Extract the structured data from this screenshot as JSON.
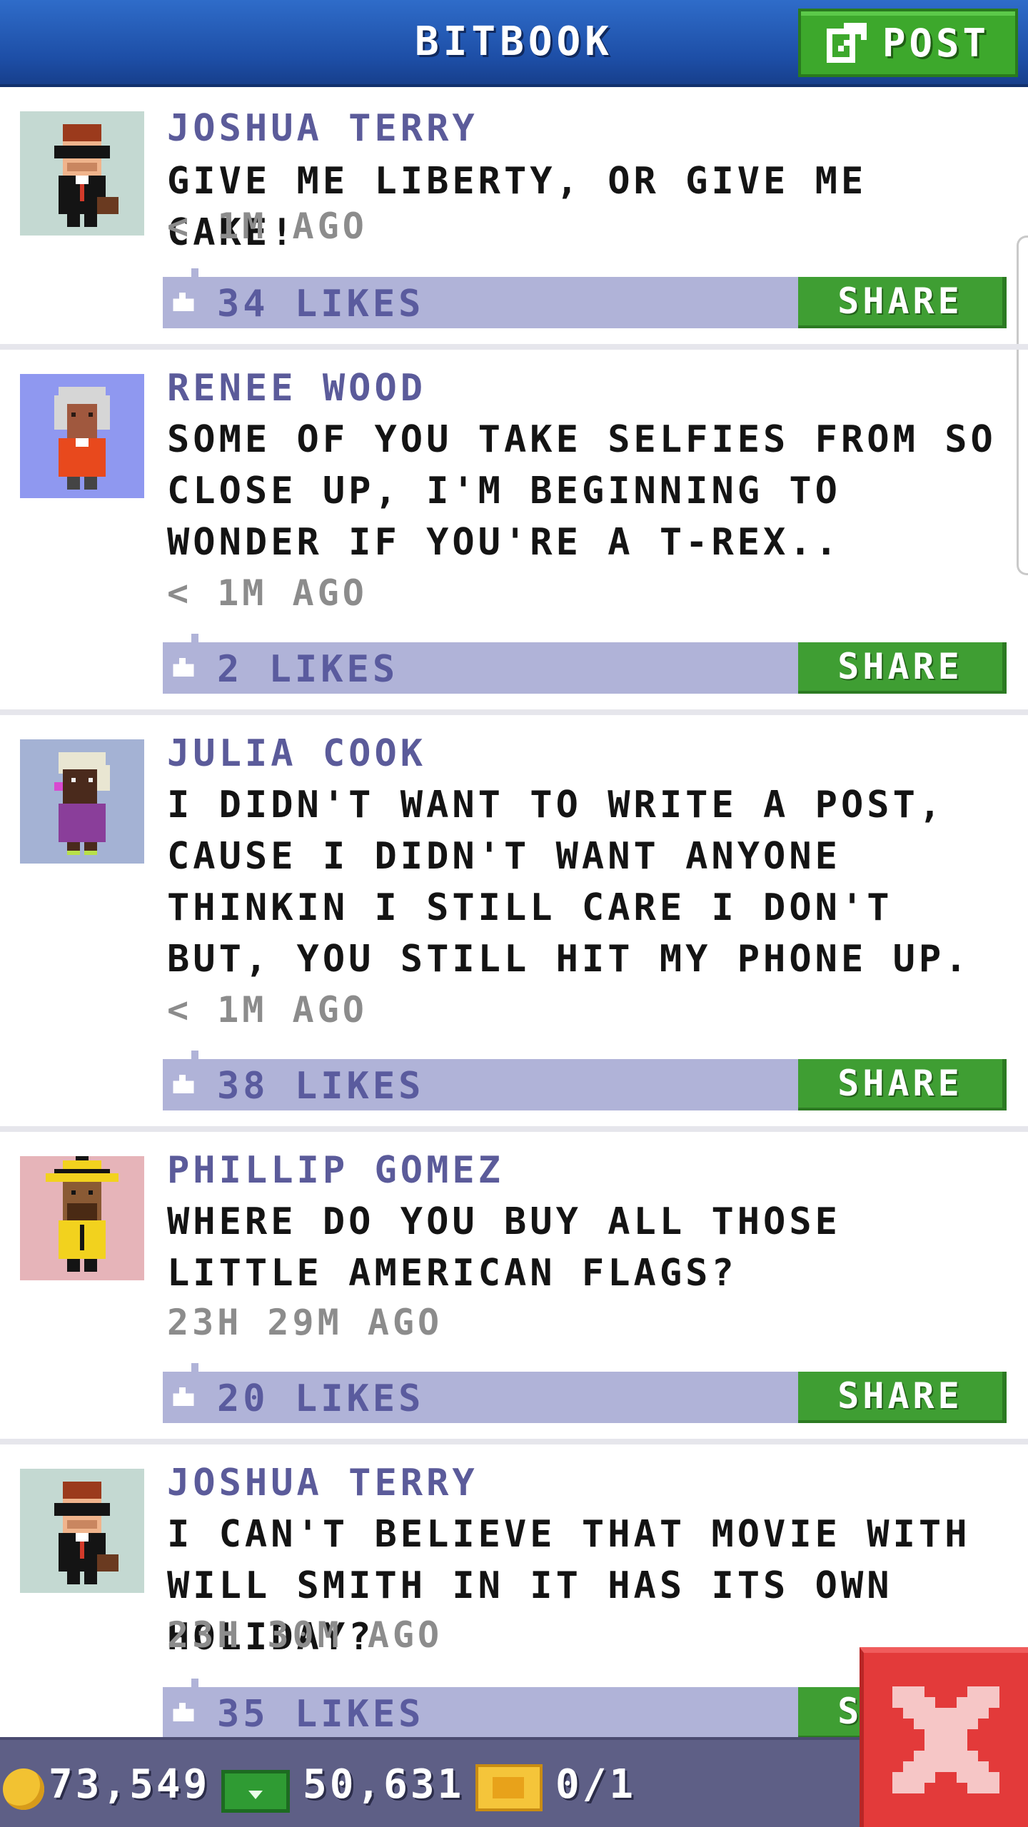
{
  "header": {
    "title": "BITBOOK",
    "post_label": "POST"
  },
  "posts": [
    {
      "author": "JOSHUA TERRY",
      "text": "GIVE ME LIBERTY, OR GIVE ME CAKE!",
      "time": "< 1M AGO",
      "likes": "34 LIKES",
      "share_label": "SHARE",
      "avatar_bg": "#c4d9d2",
      "avatar_icon": "businessman-sunglasses-avatar"
    },
    {
      "author": "RENEE WOOD",
      "text": "SOME OF YOU TAKE SELFIES FROM SO CLOSE UP, I'M BEGINNING TO WONDER IF YOU'RE A T-REX..",
      "time": "< 1M AGO",
      "likes": "2 LIKES",
      "share_label": "SHARE",
      "avatar_bg": "#8f98f0",
      "avatar_icon": "elderly-woman-avatar"
    },
    {
      "author": "JULIA COOK",
      "text": "I DIDN'T WANT TO WRITE A POST, CAUSE I DIDN'T WANT ANYONE THINKIN I STILL CARE I DON'T BUT, YOU STILL HIT MY PHONE UP.",
      "time": "< 1M AGO",
      "likes": "38 LIKES",
      "share_label": "SHARE",
      "avatar_bg": "#a4b2d4",
      "avatar_icon": "woman-purple-dress-avatar"
    },
    {
      "author": "PHILLIP GOMEZ",
      "text": "WHERE DO YOU BUY ALL THOSE LITTLE AMERICAN FLAGS?",
      "time": "23H 29M AGO",
      "likes": "20 LIKES",
      "share_label": "SHARE",
      "avatar_bg": "#e6b4b9",
      "avatar_icon": "man-yellow-hat-avatar"
    },
    {
      "author": "JOSHUA TERRY",
      "text": "I CAN'T BELIEVE THAT MOVIE WITH WILL SMITH IN IT HAS ITS OWN HOLIDAY?",
      "time": "23H 30M AGO",
      "likes": "35 LIKES",
      "share_label": "SHARE",
      "avatar_bg": "#c4d9d2",
      "avatar_icon": "businessman-sunglasses-avatar"
    }
  ],
  "footer": {
    "coins": "73,549",
    "bux": "50,631",
    "tickets": "0/1"
  },
  "colors": {
    "header_blue": "#1d4ea6",
    "share_green": "#3f9e33",
    "likes_bar": "#b0b3d8",
    "author_purple": "#5b5b9a",
    "close_red": "#e33a3a"
  }
}
